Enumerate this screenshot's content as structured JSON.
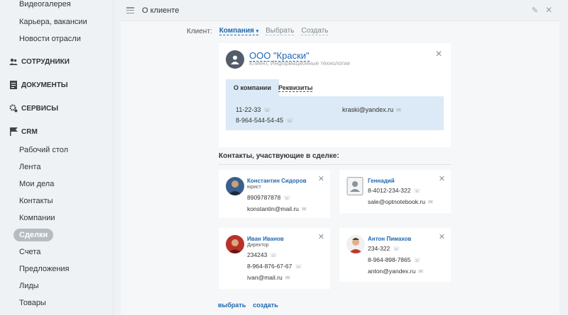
{
  "sidebar": {
    "top_items": [
      "Видеогалерея",
      "Карьера, вакансии",
      "Новости отрасли"
    ],
    "sections": [
      {
        "icon": "people-icon",
        "label": "СОТРУДНИКИ"
      },
      {
        "icon": "document-icon",
        "label": "ДОКУМЕНТЫ"
      },
      {
        "icon": "gears-icon",
        "label": "СЕРВИСЫ"
      },
      {
        "icon": "flag-icon",
        "label": "CRM"
      }
    ],
    "crm_items": [
      "Рабочий стол",
      "Лента",
      "Мои дела",
      "Контакты",
      "Компании",
      "Сделки",
      "Счета",
      "Предложения",
      "Лиды",
      "Товары"
    ],
    "active_item": "Сделки"
  },
  "header": {
    "title": "О клиенте"
  },
  "client": {
    "label": "Клиент:",
    "type_selected": "Компания",
    "choose": "Выбрать",
    "create": "Создать"
  },
  "company": {
    "name": "ООО \"Краски\"",
    "subtitle": "Клиент, Информационные технологии",
    "tabs": [
      "О компании",
      "Реквизиты"
    ],
    "phones": [
      "11-22-33",
      "8-964-544-54-45"
    ],
    "email": "kraski@yandex.ru"
  },
  "contacts_title": "Контакты, участвующие в сделке:",
  "contacts": [
    {
      "name": "Константин Сидоров",
      "role": "юрист",
      "lines": [
        "8909787878",
        "konstantin@mail.ru"
      ]
    },
    {
      "name": "Геннадий",
      "role": "",
      "lines": [
        "8-4012-234-322",
        "sale@optnotebook.ru"
      ]
    },
    {
      "name": "Иван Иванов",
      "role": "Директор",
      "lines": [
        "234243",
        "8-964-876-67-67",
        "ivan@mail.ru"
      ]
    },
    {
      "name": "Антон Пимахов",
      "role": "",
      "lines": [
        "234-322",
        "8-964-898-7865",
        "anton@yandex.ru"
      ]
    }
  ],
  "footer": {
    "choose": "выбрать",
    "create": "создать"
  },
  "colors": {
    "link": "#2067b0",
    "panel_bg": "#dbeaf6",
    "active_pill": "#b5bcc2"
  }
}
